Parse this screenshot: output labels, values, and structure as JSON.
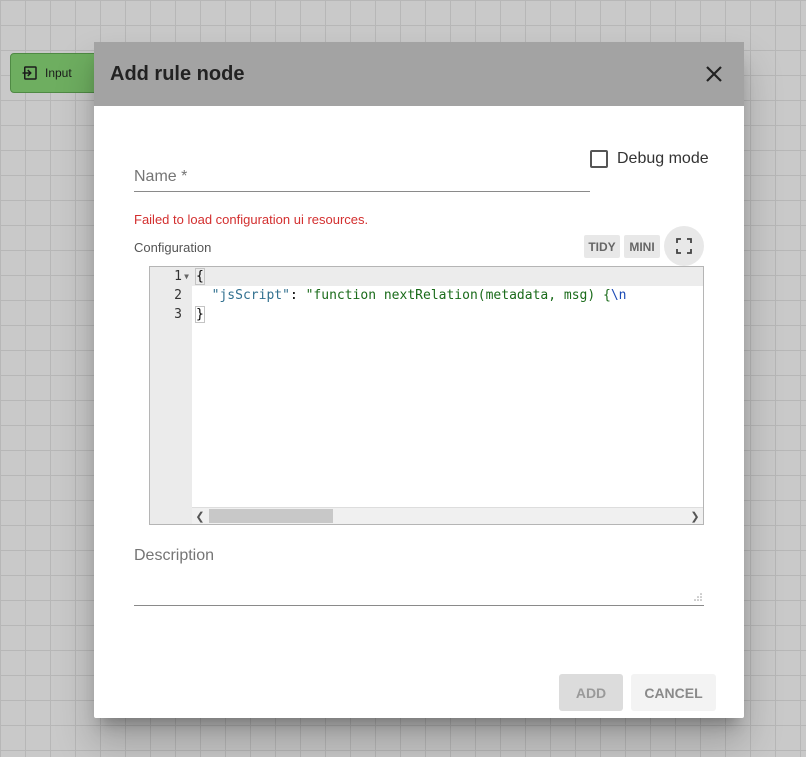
{
  "canvas": {
    "node_label": "Input",
    "node_icon": "input-icon",
    "node_color": "#6eae60"
  },
  "dialog": {
    "title": "Add rule node",
    "close_icon": "close-icon",
    "header_color": "#a3a3a3"
  },
  "form": {
    "name_label": "Name *",
    "debug_label": "Debug mode",
    "error_message": "Failed to load configuration ui resources.",
    "error_color": "#d32f2f",
    "configuration_label": "Configuration",
    "tidy_label": "TIDY",
    "mini_label": "MINI",
    "fullscreen_icon": "fullscreen-icon",
    "description_label": "Description"
  },
  "editor": {
    "line_numbers": [
      "1",
      "2",
      "3"
    ],
    "lines": [
      "{",
      "  \"jsScript\": \"function nextRelation(metadata, msg) {\\n",
      "}"
    ],
    "key": "\"jsScript\"",
    "value": "\"function nextRelation(metadata, msg) {",
    "escape": "\\n"
  },
  "footer": {
    "add_label": "ADD",
    "cancel_label": "CANCEL"
  }
}
